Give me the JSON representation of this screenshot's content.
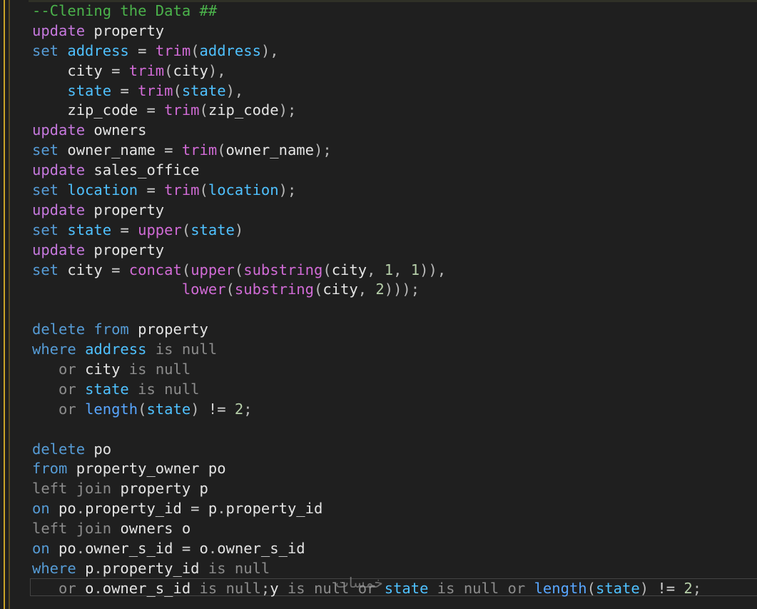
{
  "colors": {
    "background": "#1f1f1f",
    "keyword_update": "#c678dd",
    "keyword_blue": "#569cd6",
    "identifier": "#e4e4e4",
    "column": "#4fc1ff",
    "function": "#d16bd6",
    "number": "#b5cea8",
    "dim_keyword": "#8c8c8c",
    "comment": "#4bb34b",
    "indent_guide": "#c9a227"
  },
  "lines": [
    "--Clening the Data ##",
    "update property",
    "set address = trim(address),",
    "    city = trim(city),",
    "    state = trim(state),",
    "    zip_code = trim(zip_code);",
    "update owners",
    "set owner_name = trim(owner_name);",
    "update sales_office",
    "set location = trim(location);",
    "update property",
    "set state = upper(state)",
    "update property",
    "set city = concat(upper(substring(city, 1, 1)),",
    "                 lower(substring(city, 2)));",
    "",
    "delete from property",
    "where address is null",
    "   or city is null",
    "   or state is null",
    "   or length(state) != 2;",
    "",
    "delete po",
    "from property_owner po",
    "left join property p",
    "on po.property_id = p.property_id",
    "left join owners o",
    "on po.owner_s_id = o.owner_s_id",
    "where p.property_id is null",
    "   or o.owner_s_id is null;y is null or state is null or length(state) != 2;"
  ],
  "watermark": "خمسات"
}
